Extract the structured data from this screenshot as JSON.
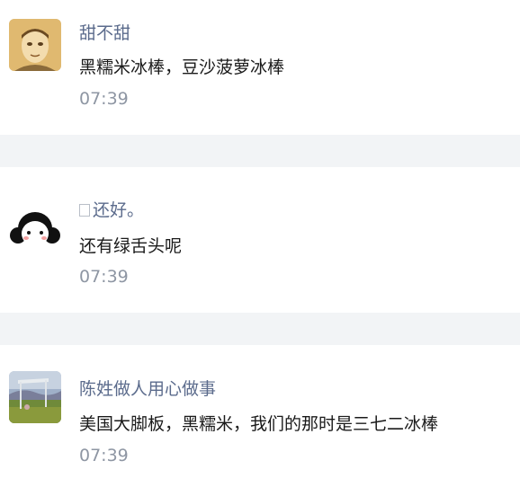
{
  "comments": [
    {
      "name": "甜不甜",
      "text": "黑糯米冰棒，豆沙菠萝冰棒",
      "time": "07:39",
      "avatar": "man-portrait-avatar"
    },
    {
      "name": "还好。",
      "name_prefix_glyph": "missing-glyph-box",
      "text": "还有绿舌头呢",
      "time": "07:39",
      "avatar": "cartoon-girl-avatar"
    },
    {
      "name": "陈姓做人用心做事",
      "text": "美国大脚板，黑糯米，我们的那时是三七二冰棒",
      "time": "07:39",
      "avatar": "landscape-photo-avatar"
    }
  ],
  "colors": {
    "name": "#5b6b8c",
    "text": "#1a1a1a",
    "time": "#8e96a3",
    "divider": "#f2f4f6"
  }
}
